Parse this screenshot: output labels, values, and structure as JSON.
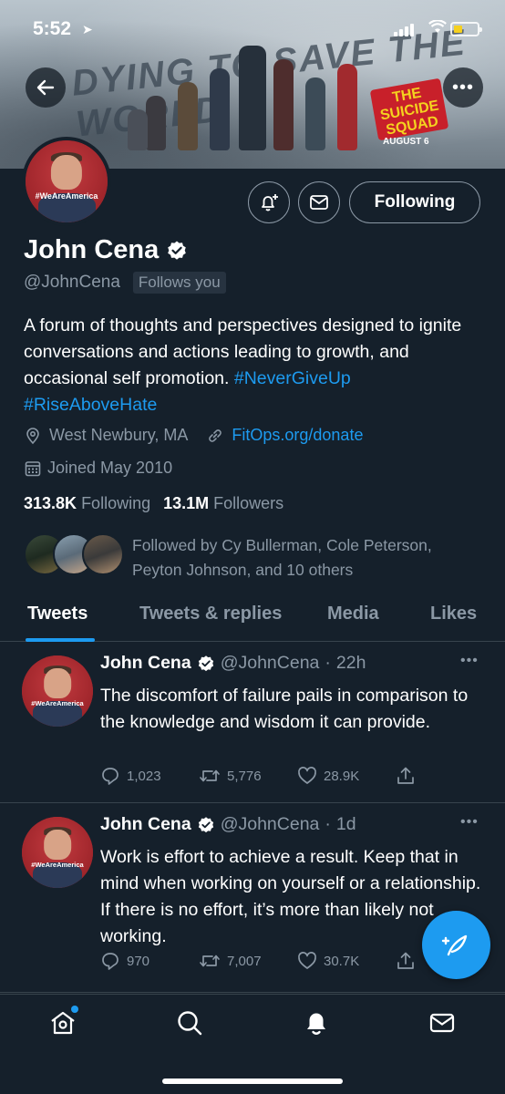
{
  "status_bar": {
    "time": "5:52"
  },
  "banner": {
    "title_art": "DYING TO SAVE THE WORLD",
    "movie_logo": "THE SUICIDE SQUAD",
    "release": "AUGUST 6"
  },
  "header_buttons": {
    "back_icon": "arrow-left-icon",
    "more_icon": "more-horizontal-icon",
    "notify_icon": "bell-plus-icon",
    "message_icon": "envelope-icon",
    "follow_label": "Following"
  },
  "profile": {
    "avatar_text": "#WeAreAmerica",
    "name": "John Cena",
    "handle": "@JohnCena",
    "follows_you": "Follows you",
    "bio_text": "A forum of thoughts and perspectives designed to ignite conversations and actions leading to growth, and occasional self promotion.",
    "bio_tag1": "#NeverGiveUp",
    "bio_tag2": "#RiseAboveHate",
    "location": "West Newbury, MA",
    "website": "FitOps.org/donate",
    "joined": "Joined May 2010",
    "following_count": "313.8K",
    "following_label": "Following",
    "followers_count": "13.1M",
    "followers_label": "Followers",
    "followed_by": "Followed by Cy Bullerman, Cole Peterson, Peyton Johnson, and 10 others"
  },
  "tabs": [
    {
      "label": "Tweets",
      "active": true
    },
    {
      "label": "Tweets & replies",
      "active": false
    },
    {
      "label": "Media",
      "active": false
    },
    {
      "label": "Likes",
      "active": false
    }
  ],
  "tweets": [
    {
      "name": "John Cena",
      "handle": "@JohnCena",
      "time": "22h",
      "text": "The discomfort of failure pails in comparison to the knowledge and wisdom it can provide.",
      "replies": "1,023",
      "retweets": "5,776",
      "likes": "28.9K"
    },
    {
      "name": "John Cena",
      "handle": "@JohnCena",
      "time": "1d",
      "text": "Work is effort to achieve a result. Keep that in mind when working on yourself or a relationship. If there is no effort, it’s more than likely not working.",
      "replies": "970",
      "retweets": "7,007",
      "likes": "30.7K"
    }
  ],
  "fab": {
    "icon": "compose-tweet-icon"
  },
  "bottom_nav": [
    {
      "icon": "home-icon"
    },
    {
      "icon": "search-icon"
    },
    {
      "icon": "bell-icon"
    },
    {
      "icon": "envelope-icon"
    }
  ],
  "colors": {
    "background": "#15202b",
    "accent": "#1d9bf0",
    "muted": "#8b98a5",
    "border": "#38444d"
  }
}
